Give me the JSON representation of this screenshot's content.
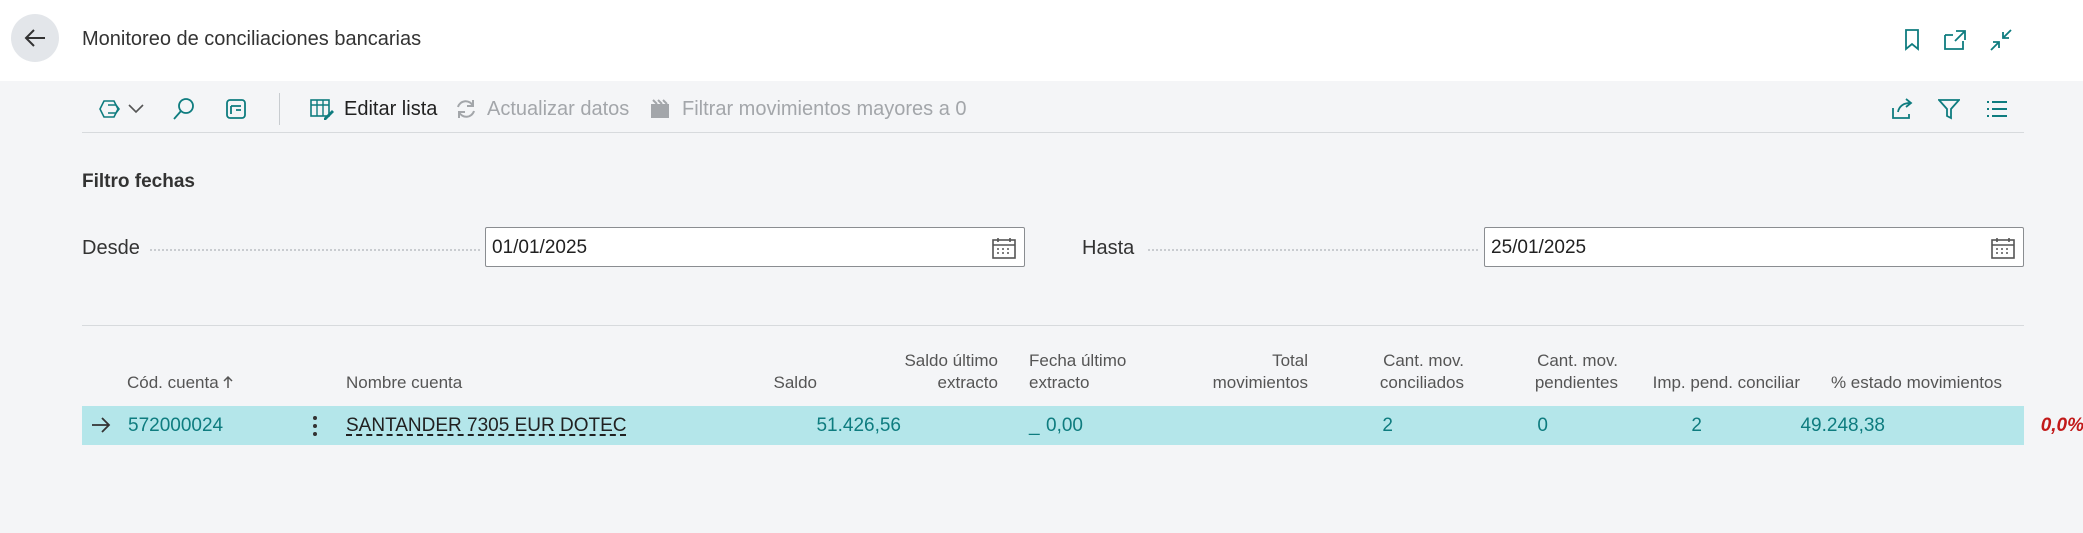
{
  "page": {
    "title": "Monitoreo de conciliaciones bancarias"
  },
  "toolbar": {
    "edit_list": "Editar lista",
    "refresh_data": "Actualizar datos",
    "filter_movements": "Filtrar movimientos mayores a 0"
  },
  "filter": {
    "section_title": "Filtro fechas",
    "from_label": "Desde",
    "from_value": "01/01/2025",
    "to_label": "Hasta",
    "to_value": "25/01/2025"
  },
  "table": {
    "columns": {
      "account_code": "Cód. cuenta",
      "account_name": "Nombre cuenta",
      "balance": "Saldo",
      "last_statement_balance_1": "Saldo último",
      "last_statement_balance_2": "extracto",
      "last_statement_date_1": "Fecha último",
      "last_statement_date_2": "extracto",
      "total_movements_1": "Total",
      "total_movements_2": "movimientos",
      "reconciled_1": "Cant. mov.",
      "reconciled_2": "conciliados",
      "pending_1": "Cant. mov.",
      "pending_2": "pendientes",
      "pending_amount": "Imp. pend. conciliar",
      "status_pct": "% estado movimientos"
    },
    "rows": [
      {
        "account_code": "572000024",
        "account_name": "SANTANDER 7305 EUR DOTEC",
        "balance": "51.426,56",
        "last_statement_balance": "0,00",
        "last_statement_date": "_",
        "total_movements": "2",
        "reconciled": "0",
        "pending": "2",
        "pending_amount": "49.248,38",
        "status_pct": "0,0%"
      }
    ]
  },
  "colors": {
    "accent": "#0e7c7f",
    "row_selected": "#b4e6ea",
    "negative": "#c21a1a"
  }
}
